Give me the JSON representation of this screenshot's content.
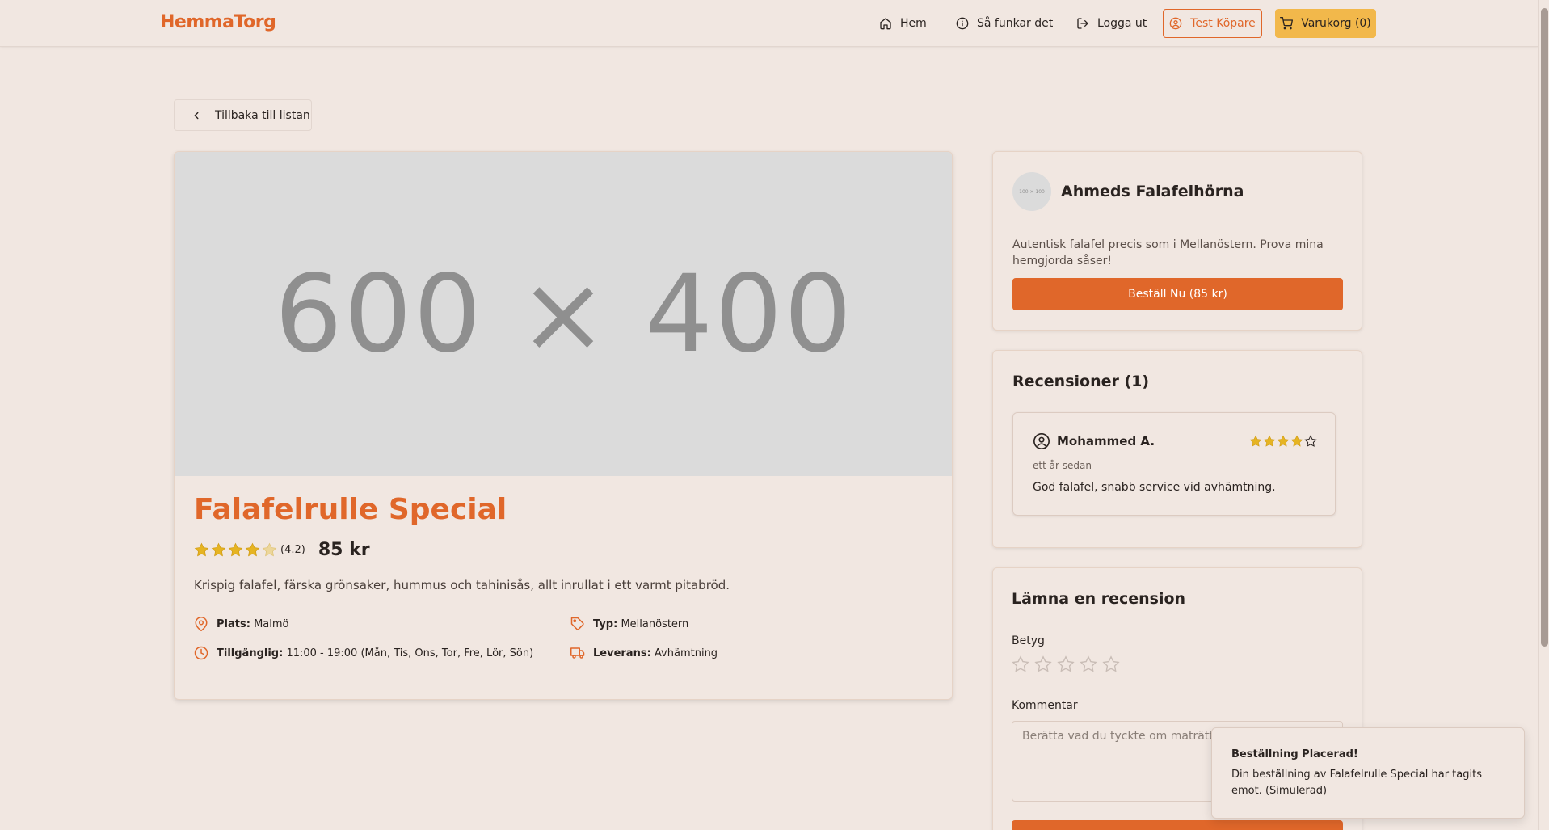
{
  "header": {
    "logo": "HemmaTorg",
    "nav": {
      "home": "Hem",
      "how": "Så funkar det",
      "logout": "Logga ut"
    },
    "user_button": "Test Köpare",
    "cart_button": "Varukorg (0)"
  },
  "back_button": "Tillbaka till listan",
  "product": {
    "image_placeholder": "600 × 400",
    "title": "Falafelrulle Special",
    "rating": 4.2,
    "rating_text": "(4.2)",
    "price": "85 kr",
    "description": "Krispig falafel, färska grönsaker, hummus och tahinisås, allt inrullat i ett varmt pitabröd.",
    "info": {
      "location_label": "Plats:",
      "location_value": "Malmö",
      "type_label": "Typ:",
      "type_value": "Mellanöstern",
      "available_label": "Tillgänglig:",
      "available_value": "11:00 - 19:00 (Mån, Tis, Ons, Tor, Fre, Lör, Sön)",
      "delivery_label": "Leverans:",
      "delivery_value": "Avhämtning"
    }
  },
  "seller": {
    "avatar_placeholder": "100 × 100",
    "name": "Ahmeds Falafelhörna",
    "description": "Autentisk falafel precis som i Mellanöstern. Prova mina hemgjorda såser!",
    "order_button": "Beställ Nu (85 kr)"
  },
  "reviews": {
    "heading": "Recensioner (1)",
    "items": [
      {
        "user": "Mohammed A.",
        "stars": 4,
        "date": "ett år sedan",
        "text": "God falafel, snabb service vid avhämtning."
      }
    ]
  },
  "leave_review": {
    "heading": "Lämna en recension",
    "rating_label": "Betyg",
    "comment_label": "Kommentar",
    "comment_placeholder": "Berätta vad du tyckte om maträtten..."
  },
  "toast": {
    "title": "Beställning Placerad!",
    "text": "Din beställning av Falafelrulle Special har tagits emot. (Simulerad)"
  },
  "colors": {
    "accent": "#e0672a",
    "star": "#e6b422",
    "cart": "#f2b84b",
    "background": "#f1e7e1"
  }
}
